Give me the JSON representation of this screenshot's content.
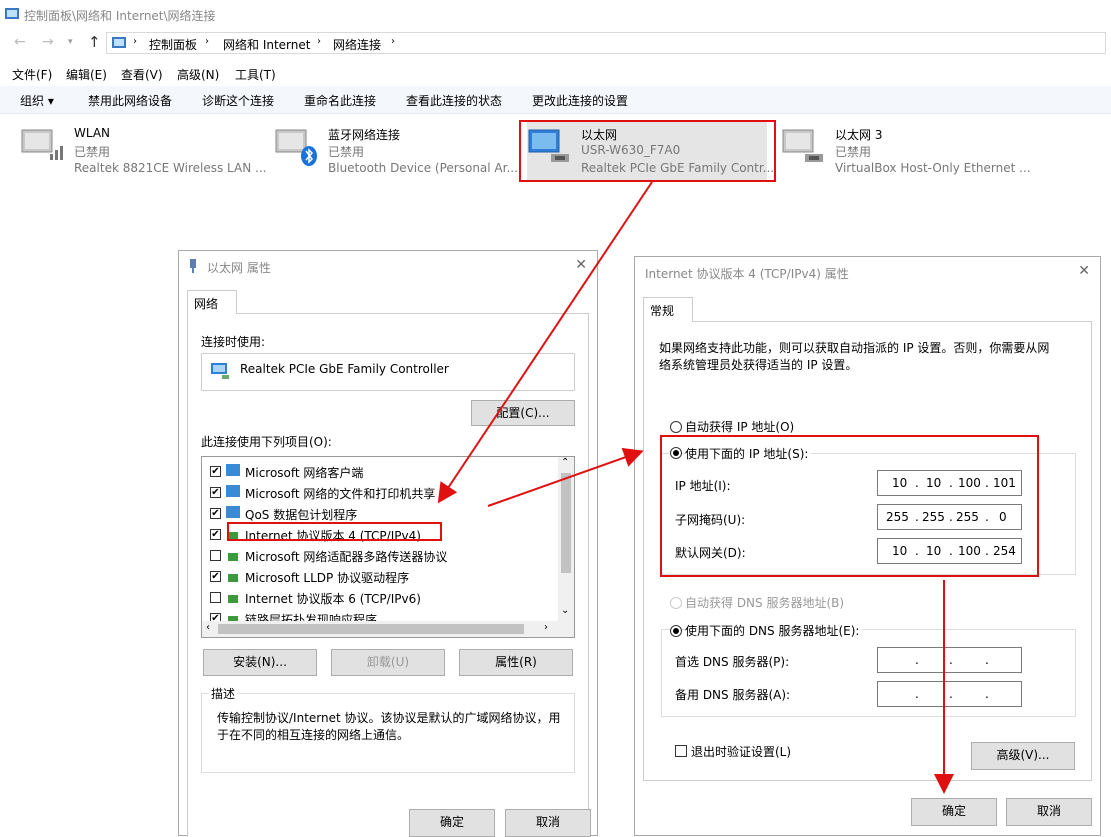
{
  "window": {
    "title": "控制面板\\网络和 Internet\\网络连接"
  },
  "address": {
    "crumbs": [
      "控制面板",
      "网络和 Internet",
      "网络连接"
    ]
  },
  "menu": [
    "文件(F)",
    "编辑(E)",
    "查看(V)",
    "高级(N)",
    "工具(T)"
  ],
  "commands": [
    "组织 ▾",
    "禁用此网络设备",
    "诊断这个连接",
    "重命名此连接",
    "查看此连接的状态",
    "更改此连接的设置"
  ],
  "adapters": [
    {
      "name": "WLAN",
      "status": "已禁用",
      "device": "Realtek 8821CE Wireless LAN ..."
    },
    {
      "name": "蓝牙网络连接",
      "status": "已禁用",
      "device": "Bluetooth Device (Personal Ar..."
    },
    {
      "name": "以太网",
      "status": "USR-W630_F7A0",
      "device": "Realtek PCIe GbE Family Contr..."
    },
    {
      "name": "以太网 3",
      "status": "已禁用",
      "device": "VirtualBox Host-Only Ethernet ..."
    }
  ],
  "props": {
    "title": "以太网 属性",
    "tab": "网络",
    "connect_using_label": "连接时使用:",
    "adapter_name": "Realtek PCIe GbE Family Controller",
    "configure": "配置(C)...",
    "items_label": "此连接使用下列项目(O):",
    "items": [
      {
        "label": "Microsoft 网络客户端",
        "checked": "✔"
      },
      {
        "label": "Microsoft 网络的文件和打印机共享",
        "checked": "✔"
      },
      {
        "label": "QoS 数据包计划程序",
        "checked": "✔"
      },
      {
        "label": "Internet 协议版本 4 (TCP/IPv4)",
        "checked": "✔"
      },
      {
        "label": "Microsoft 网络适配器多路传送器协议",
        "checked": ""
      },
      {
        "label": "Microsoft LLDP 协议驱动程序",
        "checked": "✔"
      },
      {
        "label": "Internet 协议版本 6 (TCP/IPv6)",
        "checked": ""
      },
      {
        "label": "链路层拓扑发现响应程序",
        "checked": "✔"
      }
    ],
    "install": "安装(N)...",
    "uninstall": "卸载(U)",
    "properties": "属性(R)",
    "desc_label": "描述",
    "desc_text_1": "传输控制协议/Internet 协议。该协议是默认的广域网络协议，用",
    "desc_text_2": "于在不同的相互连接的网络上通信。",
    "ok": "确定",
    "cancel": "取消"
  },
  "ipv4": {
    "title": "Internet 协议版本 4 (TCP/IPv4) 属性",
    "tab": "常规",
    "intro_1": "如果网络支持此功能，则可以获取自动指派的 IP 设置。否则，你需要从网",
    "intro_2": "络系统管理员处获得适当的 IP 设置。",
    "auto_ip": "自动获得 IP 地址(O)",
    "manual_ip": "使用下面的 IP 地址(S):",
    "ip_label": "IP 地址(I):",
    "mask_label": "子网掩码(U):",
    "gw_label": "默认网关(D):",
    "ip": [
      "10",
      "10",
      "100",
      "101"
    ],
    "mask": [
      "255",
      "255",
      "255",
      "0"
    ],
    "gw": [
      "10",
      "10",
      "100",
      "254"
    ],
    "auto_dns": "自动获得 DNS 服务器地址(B)",
    "manual_dns": "使用下面的 DNS 服务器地址(E):",
    "dns1_label": "首选 DNS 服务器(P):",
    "dns2_label": "备用 DNS 服务器(A):",
    "validate": "退出时验证设置(L)",
    "advanced": "高级(V)...",
    "ok": "确定",
    "cancel": "取消"
  },
  "colors": {
    "annotation": "#e01010",
    "cmdbar": "#f4f7fb"
  }
}
